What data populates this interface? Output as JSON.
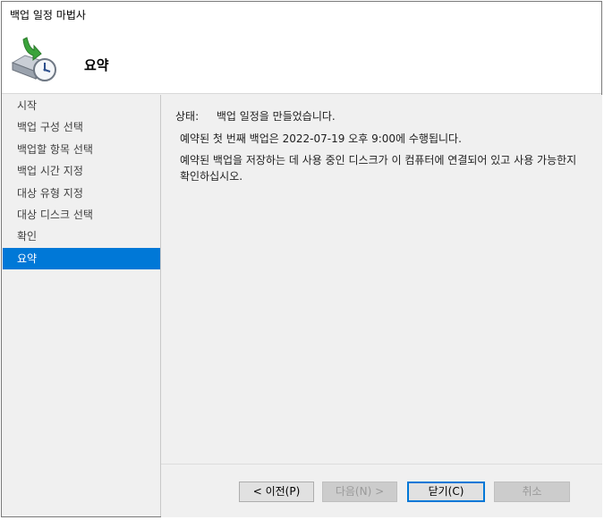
{
  "window": {
    "title": "백업 일정 마법사"
  },
  "header": {
    "title": "요약",
    "icon": "backup-schedule-icon"
  },
  "sidebar": {
    "items": [
      {
        "label": "시작"
      },
      {
        "label": "백업 구성 선택"
      },
      {
        "label": "백업할 항목 선택"
      },
      {
        "label": "백업 시간 지정"
      },
      {
        "label": "대상 유형 지정"
      },
      {
        "label": "대상 디스크 선택"
      },
      {
        "label": "확인"
      },
      {
        "label": "요약",
        "active": true
      }
    ]
  },
  "content": {
    "status_label": "상태:",
    "status_value": "백업 일정을 만들었습니다.",
    "message1": "예약된 첫 번째 백업은 2022-07-19 오후 9:00에 수행됩니다.",
    "message2": "예약된 백업을 저장하는 데 사용 중인 디스크가 이 컴퓨터에 연결되어 있고 사용 가능한지 확인하십시오."
  },
  "buttons": {
    "previous": "< 이전(P)",
    "next": "다음(N) >",
    "close": "닫기(C)",
    "cancel": "취소"
  },
  "colors": {
    "selection": "#0078d7"
  }
}
